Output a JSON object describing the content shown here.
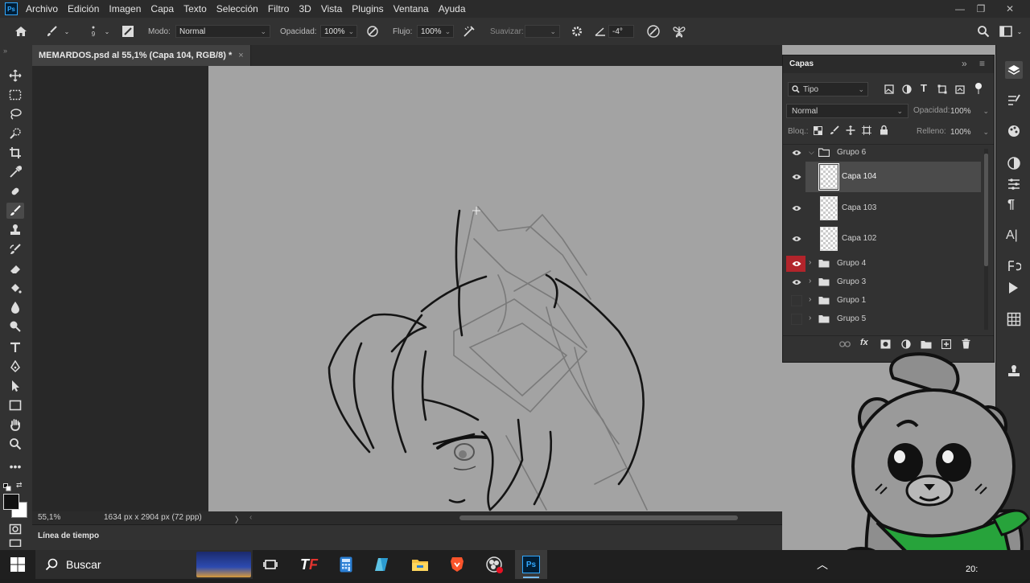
{
  "app": {
    "logo": "Ps"
  },
  "menu": [
    "Archivo",
    "Edición",
    "Imagen",
    "Capa",
    "Texto",
    "Selección",
    "Filtro",
    "3D",
    "Vista",
    "Plugins",
    "Ventana",
    "Ayuda"
  ],
  "options": {
    "brush_size": "9",
    "mode_label": "Modo:",
    "mode_value": "Normal",
    "opacity_label": "Opacidad:",
    "opacity_value": "100%",
    "flow_label": "Flujo:",
    "flow_value": "100%",
    "smooth_label": "Suavizar:",
    "smooth_value": "",
    "angle_value": "-4°"
  },
  "document": {
    "tab_title": "MEMARDOS.psd al 55,1% (Capa 104, RGB/8) *",
    "close": "×"
  },
  "status": {
    "zoom": "55,1%",
    "doc_info": "1634 px x 2904 px (72 ppp)",
    "arrow": "〉"
  },
  "timeline": {
    "label": "Línea de tiempo"
  },
  "layers_panel": {
    "title": "Capas",
    "filter_kind": "Tipo",
    "blend_mode": "Normal",
    "opacity_label": "Opacidad:",
    "opacity_value": "100%",
    "lock_label": "Bloq.:",
    "fill_label": "Relleno:",
    "fill_value": "100%",
    "layers": [
      {
        "name": "Grupo 6",
        "type": "group",
        "expanded": true
      },
      {
        "name": "Capa 104",
        "type": "layer",
        "selected": true
      },
      {
        "name": "Capa 103",
        "type": "layer"
      },
      {
        "name": "Capa 102",
        "type": "layer"
      },
      {
        "name": "Grupo 4",
        "type": "group",
        "eye_highlight": true
      },
      {
        "name": "Grupo 3",
        "type": "group"
      },
      {
        "name": "Grupo 1",
        "type": "group",
        "hidden": true
      },
      {
        "name": "Grupo 5",
        "type": "group",
        "hidden": true
      }
    ]
  },
  "taskbar": {
    "search_placeholder": "Buscar",
    "time": "20:"
  },
  "colors": {
    "accent": "#31a8ff",
    "eye_highlight": "#b2242b",
    "bandana": "#27a33b",
    "canvas_bg": "#a3a3a3"
  }
}
